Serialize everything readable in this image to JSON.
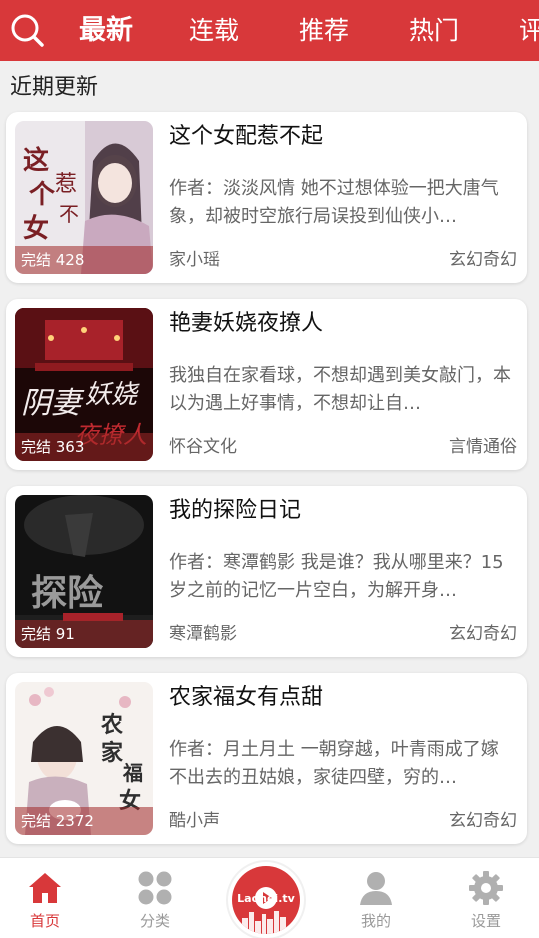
{
  "header": {
    "tabs": [
      {
        "label": "最新",
        "active": true
      },
      {
        "label": "连载",
        "active": false
      },
      {
        "label": "推荐",
        "active": false
      },
      {
        "label": "热门",
        "active": false
      },
      {
        "label": "评",
        "active": false
      }
    ]
  },
  "section_title": "近期更新",
  "books": [
    {
      "title": "这个女配惹不起",
      "description": "作者：淡淡风情 她不过想体验一把大唐气象，却被时空旅行局误投到仙侠小…",
      "author": "家小瑶",
      "genre": "玄幻奇幻",
      "badge": "完结 428",
      "cover_colors": [
        "#e8e4e8",
        "#c9b7c6",
        "#7a2a2e"
      ]
    },
    {
      "title": "艳妻妖娆夜撩人",
      "description": "我独自在家看球，不想却遇到美女敲门，本以为遇上好事情，不想却让自…",
      "author": "怀谷文化",
      "genre": "言情通俗",
      "badge": "完结 363",
      "cover_colors": [
        "#3a0f12",
        "#a8222a",
        "#f0e6e6"
      ]
    },
    {
      "title": "我的探险日记",
      "description": "作者：寒潭鹤影 我是谁？我从哪里来？15岁之前的记忆一片空白，为解开身…",
      "author": "寒潭鹤影",
      "genre": "玄幻奇幻",
      "badge": "完结 91",
      "cover_colors": [
        "#141414",
        "#2c2c2c",
        "#8a8a8a"
      ]
    },
    {
      "title": "农家福女有点甜",
      "description": "作者：月土月土 一朝穿越，叶青雨成了嫁不出去的丑姑娘，家徒四壁，穷的…",
      "author": "酷小声",
      "genre": "玄幻奇幻",
      "badge": "完结 2372",
      "cover_colors": [
        "#f4f0ee",
        "#e7c9cf",
        "#3d3d3d"
      ]
    }
  ],
  "bottom_nav": {
    "items": [
      {
        "label": "首页",
        "icon": "home-icon",
        "active": true
      },
      {
        "label": "分类",
        "icon": "category-icon",
        "active": false
      },
      {
        "label": "我的",
        "icon": "user-icon",
        "active": false
      },
      {
        "label": "设置",
        "icon": "settings-icon",
        "active": false
      }
    ],
    "center_logo": "Laohei.tv"
  },
  "colors": {
    "accent": "#d8383a",
    "text_primary": "#111111",
    "text_secondary": "#666666",
    "nav_inactive": "#9a9a9a"
  }
}
